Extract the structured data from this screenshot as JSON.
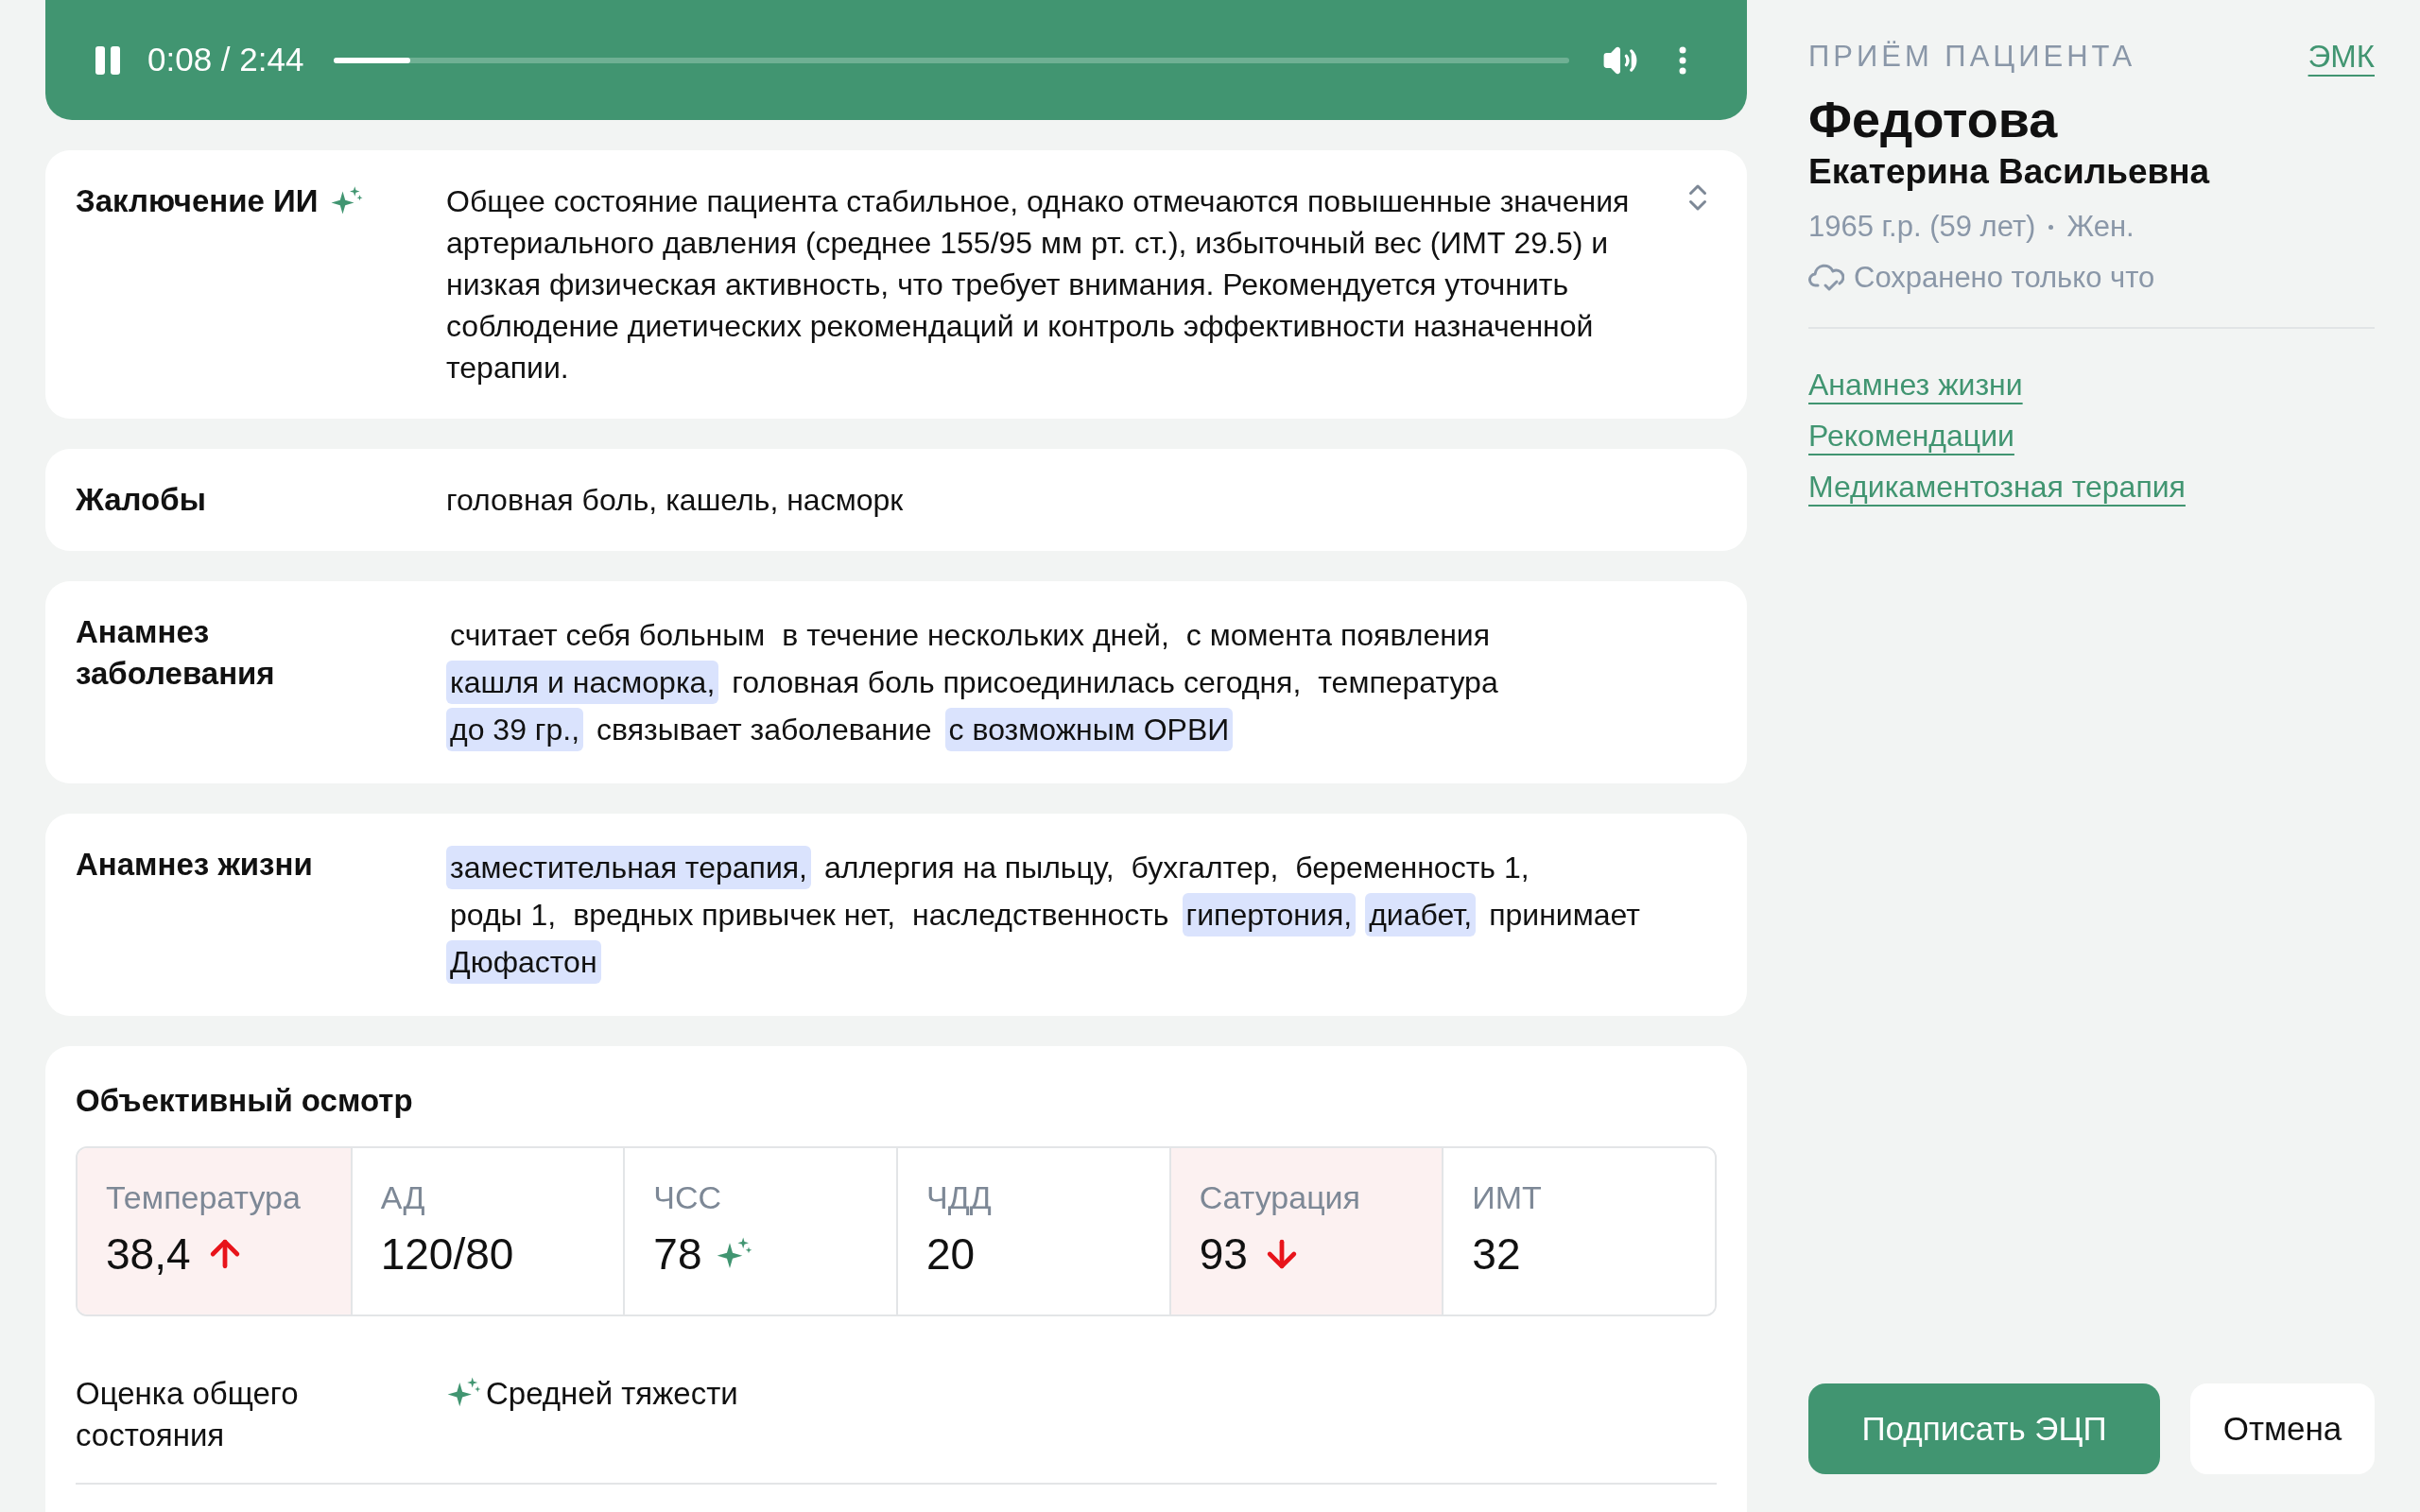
{
  "player": {
    "playing": true,
    "time": "0:08 / 2:44",
    "level": 0.062
  },
  "sections": [
    {
      "kind": "text",
      "label": "Заключение ИИ",
      "ai": true,
      "collapsible": true,
      "text": "Общее состояние пациента стабильное, однако отмечаются повышенные значения артериального давления (среднее 155/95 мм рт. ст.), избыточный вес (ИМТ 29.5) и низкая физическая активность, что требует внимания. Рекомендуется уточнить соблюдение диетических рекомендаций и контроль эффективности назначенной терапии."
    },
    {
      "kind": "text",
      "label": "Жалобы",
      "ai": false,
      "collapsible": false,
      "text": "головная боль, кашель, насморк"
    },
    {
      "kind": "fragments",
      "label": "Анамнез заболевания",
      "ai": false,
      "collapsible": false,
      "fragments": [
        {
          "text": "считает себя больным",
          "highlight": false
        },
        {
          "text": "в течение нескольких дней,",
          "highlight": false
        },
        {
          "text": "с момента появления",
          "highlight": false
        },
        {
          "text": "кашля и насморка,",
          "highlight": true
        },
        {
          "text": "головная боль присоединилась сегодня,",
          "highlight": false
        },
        {
          "text": "температура",
          "highlight": false
        },
        {
          "text": "до 39 гр.,",
          "highlight": true
        },
        {
          "text": "связывает заболевание",
          "highlight": false
        },
        {
          "text": "с возможным ОРВИ",
          "highlight": true
        }
      ]
    },
    {
      "kind": "fragments",
      "label": "Анамнез жизни",
      "ai": false,
      "collapsible": false,
      "fragments": [
        {
          "text": "заместительная терапия,",
          "highlight": true
        },
        {
          "text": "аллергия на пыльцу,",
          "highlight": false
        },
        {
          "text": "бухгалтер,",
          "highlight": false
        },
        {
          "text": "беременность 1,",
          "highlight": false
        },
        {
          "text": "роды 1,",
          "highlight": false
        },
        {
          "text": "вредных привычек нет,",
          "highlight": false
        },
        {
          "text": "наследственность",
          "highlight": false
        },
        {
          "text": "гипертония,",
          "highlight": true
        },
        {
          "text": "диабет,",
          "highlight": true
        },
        {
          "text": "принимает",
          "highlight": false
        },
        {
          "text": "Дюфастон",
          "highlight": true
        }
      ]
    }
  ],
  "exam": {
    "title": "Объективный осмотр",
    "vitals": [
      {
        "label": "Температура",
        "value": "38,4",
        "alert": true,
        "kind": "rising"
      },
      {
        "label": "АД",
        "value": "120/80",
        "alert": false,
        "kind": "plain"
      },
      {
        "label": "ЧСС",
        "value": "78",
        "alert": false,
        "kind": "ai"
      },
      {
        "label": "ЧДД",
        "value": "20",
        "alert": false,
        "kind": "plain"
      },
      {
        "label": "Сатурация",
        "value": "93",
        "alert": true,
        "kind": "falling"
      },
      {
        "label": "ИМТ",
        "value": "32",
        "alert": false,
        "kind": "plain"
      }
    ],
    "assessment": {
      "label": "Оценка общего состояния",
      "value": "Средней тяжести",
      "ai": true
    }
  },
  "patient": {
    "caption": "ПРИЁМ ПАЦИЕНТА",
    "record_link": "ЭМК",
    "surname": "Федотова",
    "given_names": "Екатерина Васильевна",
    "birth": "1965 г.р. (59 лет)",
    "sex": "Жен.",
    "save_status": "Сохранено только что",
    "links": [
      "Анамнез жизни",
      "Рекомендации",
      "Медикаментозная терапия"
    ]
  },
  "actions": {
    "primary": "Подписать ЭЦП",
    "secondary": "Отмена"
  }
}
